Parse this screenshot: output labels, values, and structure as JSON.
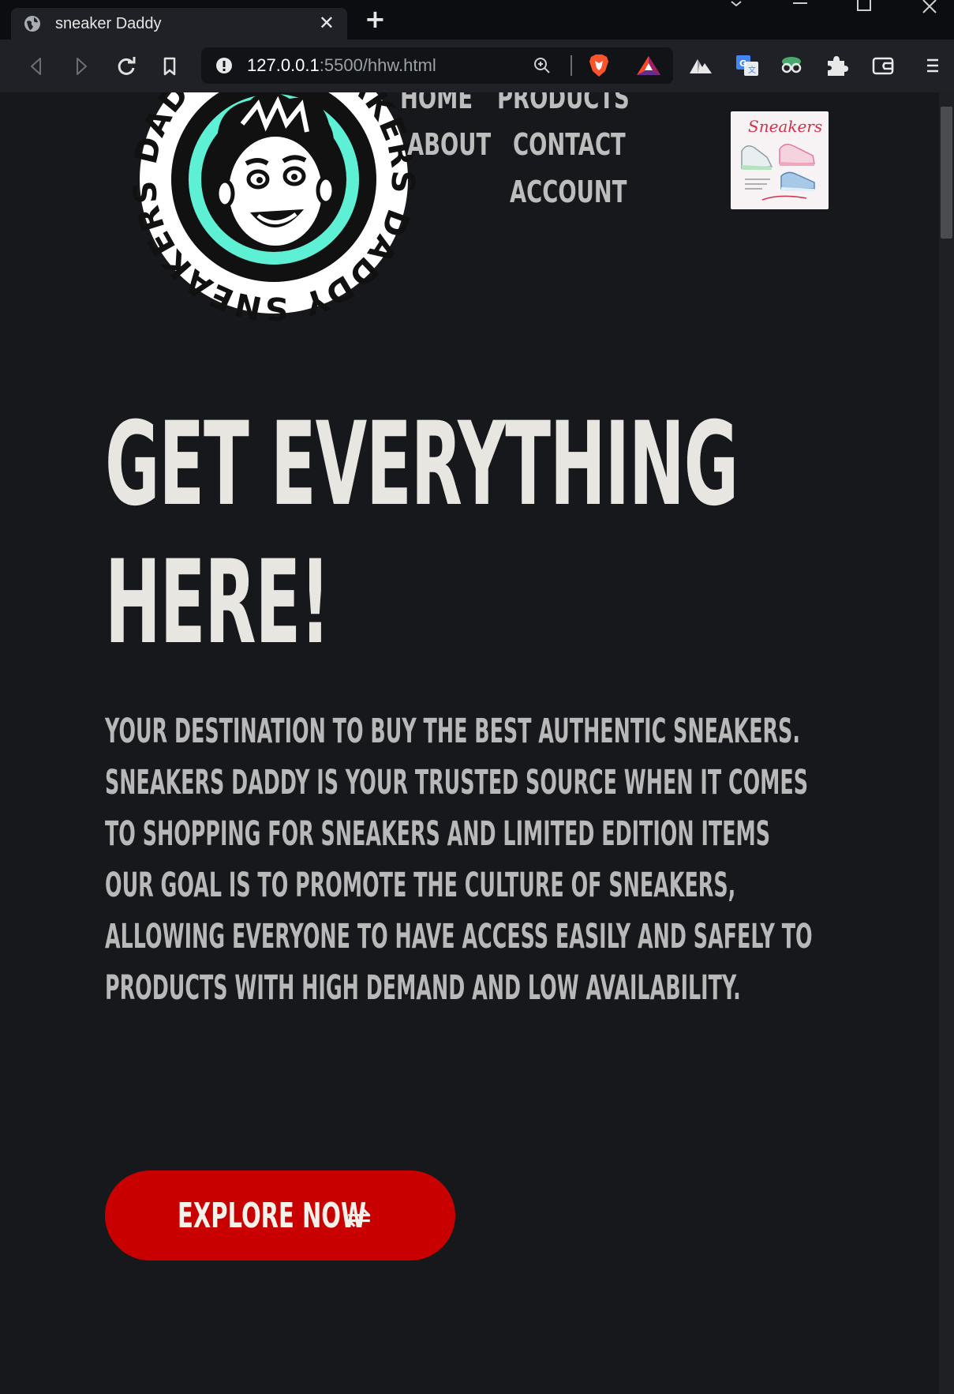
{
  "browser": {
    "tab_title": "sneaker Daddy",
    "url_host": "127.0.0.1",
    "url_rest": ":5500/hhw.html"
  },
  "logo": {
    "text": "SNEAKERS DADDY SNEAKERS DADDY",
    "ring_color": "#5ef0d4"
  },
  "nav": {
    "home": "HOME",
    "products": "PRODUCTS",
    "about": "ABOUT",
    "contact": "CONTACT",
    "account": "ACCOUNT"
  },
  "cart_thumb": {
    "text": "Sneakers"
  },
  "hero": {
    "title_lines": [
      "GET EVERYTHING",
      "HERE!"
    ],
    "paragraph_lines": [
      "YOUR DESTINATION TO BUY THE BEST AUTHENTIC SNEAKERS.",
      "SNEAKERS DADDY IS YOUR TRUSTED SOURCE WHEN IT COMES",
      "TO SHOPPING FOR SNEAKERS AND LIMITED EDITION ITEMS",
      "OUR GOAL IS TO PROMOTE THE CULTURE OF SNEAKERS,",
      "ALLOWING EVERYONE TO HAVE ACCESS EASILY AND SAFELY TO",
      "PRODUCTS WITH HIGH DEMAND AND LOW AVAILABILITY."
    ],
    "button_label": "EXPLORE NOW",
    "button_arrow": "⇌"
  },
  "colors": {
    "background": "#17181b",
    "button": "#c80000",
    "title": "#e8e6e1",
    "body_text": "#b8b8b8"
  }
}
